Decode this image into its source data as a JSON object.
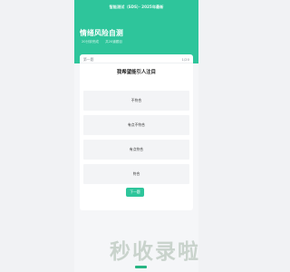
{
  "header": {
    "app_title": "智能测试（SDS）· 2025年最新",
    "test_title": "情绪风险自测",
    "meta": [
      "20分钟完成",
      "共20道题目"
    ]
  },
  "card": {
    "label": "第一题",
    "progress": "1/20",
    "question": "我希望能引人注目",
    "options": [
      "不符合",
      "有点不符合",
      "有点符合",
      "符合"
    ],
    "next_label": "下一题"
  },
  "watermark": {
    "text": "秒收录啦"
  },
  "colors": {
    "accent": "#2ec59b"
  }
}
